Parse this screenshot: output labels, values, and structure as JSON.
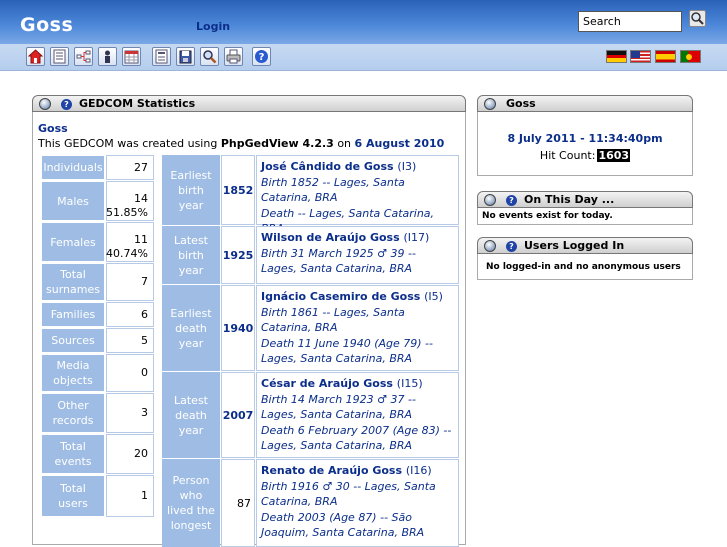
{
  "header": {
    "site_title": "Goss",
    "login_label": "Login",
    "search_value": "Search"
  },
  "toolbar": {
    "icons": [
      "home-icon",
      "list-icon",
      "chart-icon",
      "person-icon",
      "calendar-icon",
      "report-icon",
      "clipboard-icon",
      "search-icon",
      "print-icon",
      "help-icon"
    ],
    "flags": [
      "german-flag",
      "us-flag",
      "spanish-flag",
      "portuguese-flag"
    ]
  },
  "gedcom_stats": {
    "title": "GEDCOM Statistics",
    "tree_name": "Goss",
    "created_prefix": "This GEDCOM was created using ",
    "software": "PhpGedView 4.2.3",
    "on_word": " on ",
    "created_date": "6 August 2010",
    "stats": [
      {
        "label": "Individuals",
        "value": "27"
      },
      {
        "label": "Males",
        "value": "14",
        "percent": "51.85%"
      },
      {
        "label": "Females",
        "value": "11",
        "percent": "40.74%"
      },
      {
        "label": "Total surnames",
        "value": "7"
      },
      {
        "label": "Families",
        "value": "6"
      },
      {
        "label": "Sources",
        "value": "5"
      },
      {
        "label": "Media objects",
        "value": "0"
      },
      {
        "label": "Other records",
        "value": "3"
      },
      {
        "label": "Total events",
        "value": "20"
      },
      {
        "label": "Total users",
        "value": "1"
      }
    ],
    "records": [
      {
        "label": "Earliest birth year",
        "year": "1852",
        "name": "José Cândido de Goss",
        "id": "(I3)",
        "line1": "Birth 1852 -- Lages, Santa Catarina, BRA",
        "line2": "Death -- Lages, Santa Catarina, BRA"
      },
      {
        "label": "Latest birth year",
        "year": "1925",
        "name": "Wilson de Araújo Goss",
        "id": "(I17)",
        "line1": "Birth 31 March 1925 ♂ 39 -- Lages, Santa Catarina, BRA",
        "line2": ""
      },
      {
        "label": "Earliest death year",
        "year": "1940",
        "name": "Ignácio Casemiro de Goss",
        "id": "(I5)",
        "line1": "Birth 1861 -- Lages, Santa Catarina, BRA",
        "line2": "Death 11 June 1940 (Age 79) -- Lages, Santa Catarina, BRA"
      },
      {
        "label": "Latest death year",
        "year": "2007",
        "name": "César de Araújo Goss",
        "id": "(I15)",
        "line1": "Birth 14 March 1923 ♂ 37 -- Lages, Santa Catarina, BRA",
        "line2": "Death 6 February 2007 (Age 83) -- Lages, Santa Catarina, BRA"
      },
      {
        "label": "Person who lived the longest",
        "year": "87",
        "name": "Renato de Araújo Goss",
        "id": "(I16)",
        "line1": "Birth 1916 ♂ 30 -- Lages, Santa Catarina, BRA",
        "line2": "Death 2003 (Age 87) -- São Joaquim, Santa Catarina, BRA"
      }
    ]
  },
  "goss_box": {
    "title": "Goss",
    "datetime": "8 July 2011 - 11:34:40pm",
    "hit_label": "Hit Count:",
    "hit_count": "1603"
  },
  "on_this_day": {
    "title": "On This Day ...",
    "message": "No events exist for today."
  },
  "users_logged_in": {
    "title": "Users Logged In",
    "message": "No logged-in and no anonymous users"
  }
}
